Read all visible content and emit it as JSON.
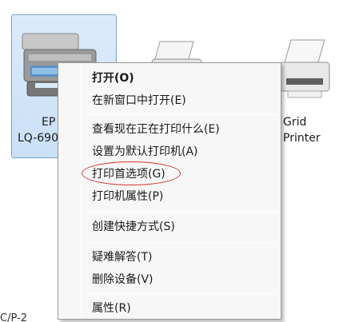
{
  "devices": [
    {
      "label_line1": "EP",
      "label_line2": "LQ-690",
      "selected": true
    },
    {
      "label_line1": "",
      "label_line2": "",
      "selected": false
    },
    {
      "label_line1": "Grid",
      "label_line2": "Printer",
      "selected": false
    }
  ],
  "bottom_label": "C/P-2",
  "context_menu": {
    "items": [
      {
        "label": "打开(O)",
        "bold": true
      },
      {
        "label": "在新窗口中打开(E)"
      },
      {
        "label": "查看现在正在打印什么(E)"
      },
      {
        "label": "设置为默认打印机(A)"
      },
      {
        "label": "打印首选项(G)"
      },
      {
        "label": "打印机属性(P)"
      },
      {
        "label": "创建快捷方式(S)"
      },
      {
        "label": "疑难解答(T)"
      },
      {
        "label": "删除设备(V)"
      },
      {
        "label": "属性(R)"
      }
    ]
  },
  "colors": {
    "selection": "#cce4f7",
    "selection_border": "#7da2ce",
    "annotation": "#d9342b",
    "menu_bg": "#f7f7f7"
  }
}
